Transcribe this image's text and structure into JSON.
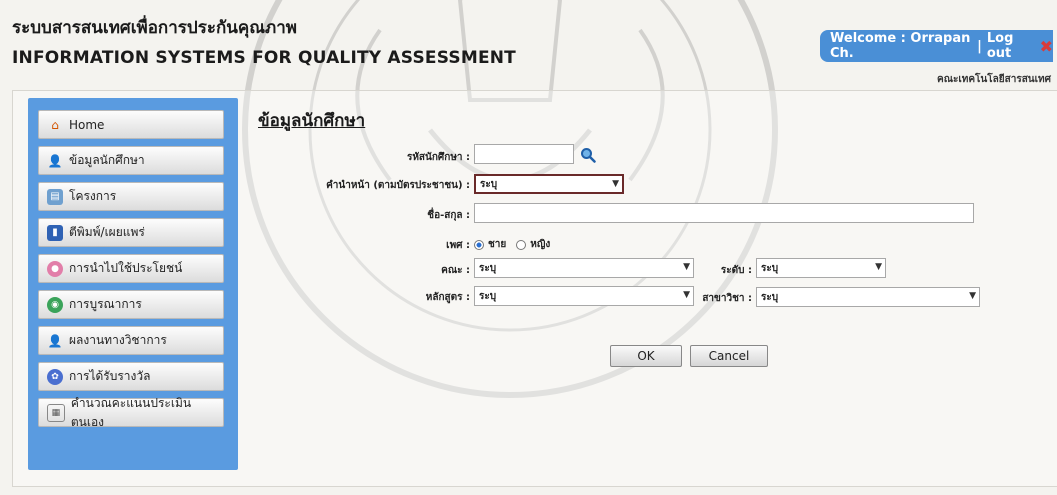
{
  "header": {
    "title_thai": "ระบบสารสนเทศเพื่อการประกันคุณภาพ",
    "title_en": "INFORMATION SYSTEMS FOR QUALITY ASSESSMENT",
    "welcome": "Welcome : Orrapan Ch.",
    "separator": "|",
    "logout": "Log out",
    "faculty": "คณะเทคโนโลยีสารสนเทศ"
  },
  "sidebar": {
    "items": [
      {
        "label": "Home",
        "icon": "home-icon"
      },
      {
        "label": "ข้อมูลนักศึกษา",
        "icon": "student-icon"
      },
      {
        "label": "โครงการ",
        "icon": "project-icon"
      },
      {
        "label": "ตีพิมพ์/เผยแพร่",
        "icon": "publish-icon"
      },
      {
        "label": "การนำไปใช้ประโยชน์",
        "icon": "utilize-icon"
      },
      {
        "label": "การบูรณาการ",
        "icon": "integration-icon"
      },
      {
        "label": "ผลงานทางวิชาการ",
        "icon": "academic-work-icon"
      },
      {
        "label": "การได้รับรางวัล",
        "icon": "award-icon"
      },
      {
        "label": "คำนวณคะแนนประเมินตนเอง",
        "icon": "calculator-icon"
      }
    ]
  },
  "form": {
    "title": "ข้อมูลนักศึกษา",
    "student_id_label": "รหัสนักศึกษา :",
    "student_id_value": "",
    "prefix_label": "คำนำหน้า (ตามบัตรประชาชน) :",
    "prefix_value": "ระบุ",
    "name_label": "ชื่อ-สกุล :",
    "name_value": "",
    "gender_label": "เพศ :",
    "gender_male": "ชาย",
    "gender_female": "หญิง",
    "faculty_label": "คณะ :",
    "faculty_value": "ระบุ",
    "level_label": "ระดับ :",
    "level_value": "ระบุ",
    "curriculum_label": "หลักสูตร :",
    "curriculum_value": "ระบุ",
    "major_label": "สาขาวิชา :",
    "major_value": "ระบุ",
    "ok_label": "OK",
    "cancel_label": "Cancel"
  }
}
